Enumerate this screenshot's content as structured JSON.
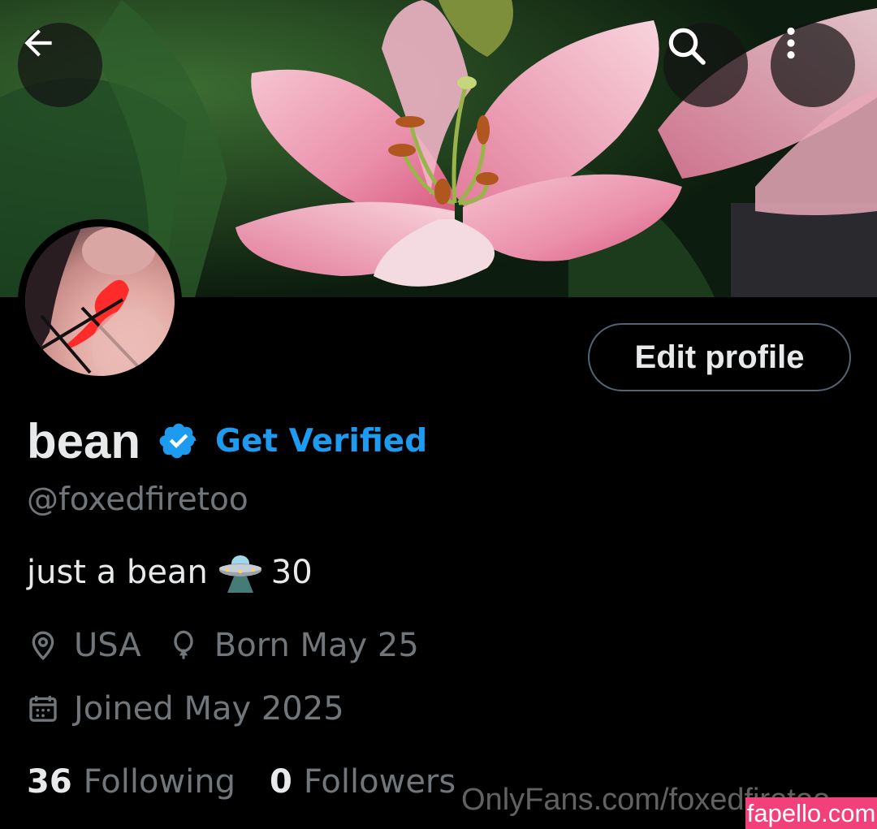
{
  "header": {
    "back_icon": "arrow-left-icon",
    "search_icon": "search-icon",
    "more_icon": "more-vertical-icon"
  },
  "profile": {
    "name": "bean",
    "verified_icon": "verified-badge-icon",
    "verified_color": "#1d9bf0",
    "get_verified_label": "Get Verified",
    "handle": "@foxedfiretoo",
    "bio_text": "just a bean",
    "bio_emoji": "ufo-emoji",
    "bio_suffix": "30",
    "location": "USA",
    "birthday": "Born May 25",
    "joined": "Joined May 2025",
    "following_count": "36",
    "following_label": "Following",
    "followers_count": "0",
    "followers_label": "Followers"
  },
  "actions": {
    "edit_profile_label": "Edit profile"
  },
  "watermarks": {
    "onlyfans_text": "OnlyFans.com/foxedfiretoo",
    "badge_text": "fapello.com",
    "badge_color": "#f2417a"
  },
  "colors": {
    "background": "#000000",
    "primary_text": "#e7e9ea",
    "secondary_text": "#71767b",
    "accent": "#1d9bf0"
  }
}
